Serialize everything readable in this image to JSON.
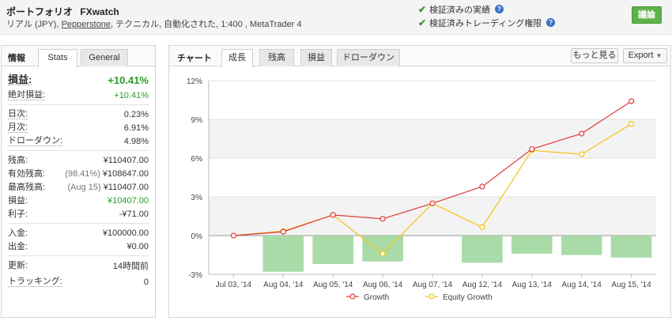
{
  "header": {
    "portfolio_label": "ポートフォリオ",
    "name": "FXwatch",
    "subtitle_pre": "リアル (JPY), ",
    "broker": "Pepperstone",
    "subtitle_post": ", テクニカル, 自動化された, 1:400 , MetaTrader 4",
    "verified_track": "検証済みの実績",
    "verified_privileges": "検証済みトレーディング権限",
    "help_glyph": "?",
    "discuss_label": "議論"
  },
  "left_panel": {
    "label": "情報",
    "tabs": [
      "Stats",
      "General"
    ],
    "gain_label": "損益:",
    "gain_value": "+10.41%",
    "abs_gain_label": "絶対損益:",
    "abs_gain_value": "+10.41%",
    "daily_label": "日次:",
    "daily_value": "0.23%",
    "monthly_label": "月次:",
    "monthly_value": "6.91%",
    "drawdown_label": "ドローダウン:",
    "drawdown_value": "4.98%",
    "balance_label": "残高:",
    "balance_value": "¥110407.00",
    "equity_label": "有効残高:",
    "equity_paren": "(98.41%)",
    "equity_value": "¥108647.00",
    "highest_label": "最高残高:",
    "highest_paren": "(Aug 15)",
    "highest_value": "¥110407.00",
    "profit_label": "損益:",
    "profit_value": "¥10407.00",
    "interest_label": "利子:",
    "interest_value": "-¥71.00",
    "deposits_label": "入金:",
    "deposits_value": "¥100000.00",
    "withdrawals_label": "出金:",
    "withdrawals_value": "¥0.00",
    "updated_label": "更新:",
    "updated_value": "14時間前",
    "tracking_label": "トラッキング:",
    "tracking_value": "0"
  },
  "right_panel": {
    "label": "チャート",
    "tabs": [
      "成長",
      "残高",
      "損益",
      "ドローダウン"
    ],
    "active_tab": 0,
    "more_button": "もっと見る",
    "export_button": "Export",
    "export_arrow": "▼"
  },
  "chart_data": {
    "type": "line",
    "categories": [
      "Jul 03, '14",
      "Aug 04, '14",
      "Aug 05, '14",
      "Aug 06, '14",
      "Aug 07, '14",
      "Aug 12, '14",
      "Aug 13, '14",
      "Aug 14, '14",
      "Aug 15, '14"
    ],
    "series": [
      {
        "name": "Growth",
        "type": "line",
        "color": "#e03a3a",
        "values": [
          0,
          0.3,
          1.6,
          1.3,
          2.5,
          3.8,
          6.7,
          7.9,
          10.41
        ]
      },
      {
        "name": "Equity Growth",
        "type": "line",
        "color": "#f1c40f",
        "values": [
          0,
          0.35,
          1.6,
          -1.4,
          2.5,
          0.65,
          6.6,
          6.3,
          8.65
        ]
      },
      {
        "type": "bar",
        "color": "#a8dba8",
        "values": [
          null,
          -2.8,
          -2.2,
          -2.0,
          0.0,
          -2.1,
          -1.4,
          -1.5,
          -1.7
        ]
      }
    ],
    "ylim": [
      -3,
      12
    ],
    "yticks": [
      "-3%",
      "0%",
      "3%",
      "6%",
      "9%",
      "12%"
    ],
    "ytick_values": [
      -3,
      0,
      3,
      6,
      9,
      12
    ],
    "legend": [
      "Growth",
      "Equity Growth"
    ],
    "legend_position": "bottom"
  }
}
